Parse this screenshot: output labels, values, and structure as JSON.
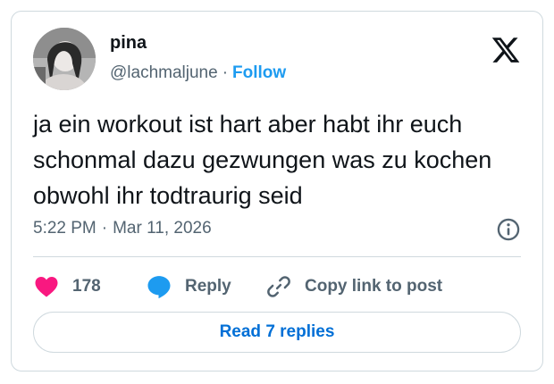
{
  "author": {
    "name": "pina",
    "handle": "@lachmaljune",
    "separator": "·",
    "follow_label": "Follow"
  },
  "tweet": {
    "text": "ja ein workout ist hart aber habt ihr euch schonmal dazu gezwungen was zu kochen obwohl ihr todtraurig seid",
    "time": "5:22 PM",
    "separator": "·",
    "date": "Mar 11, 2026"
  },
  "actions": {
    "like_count": "178",
    "reply_label": "Reply",
    "copy_link_label": "Copy link to post"
  },
  "read_replies_label": "Read 7 replies",
  "icons": {
    "brand": "x-logo-icon",
    "info": "info-icon",
    "like": "heart-icon",
    "reply": "reply-bubble-icon",
    "copy": "link-icon"
  },
  "colors": {
    "like": "#f91880",
    "reply": "#1d9bf0",
    "follow": "#1d9bf0",
    "read_replies": "#006fd6",
    "secondary_text": "#536471",
    "border": "#cfd9de"
  }
}
